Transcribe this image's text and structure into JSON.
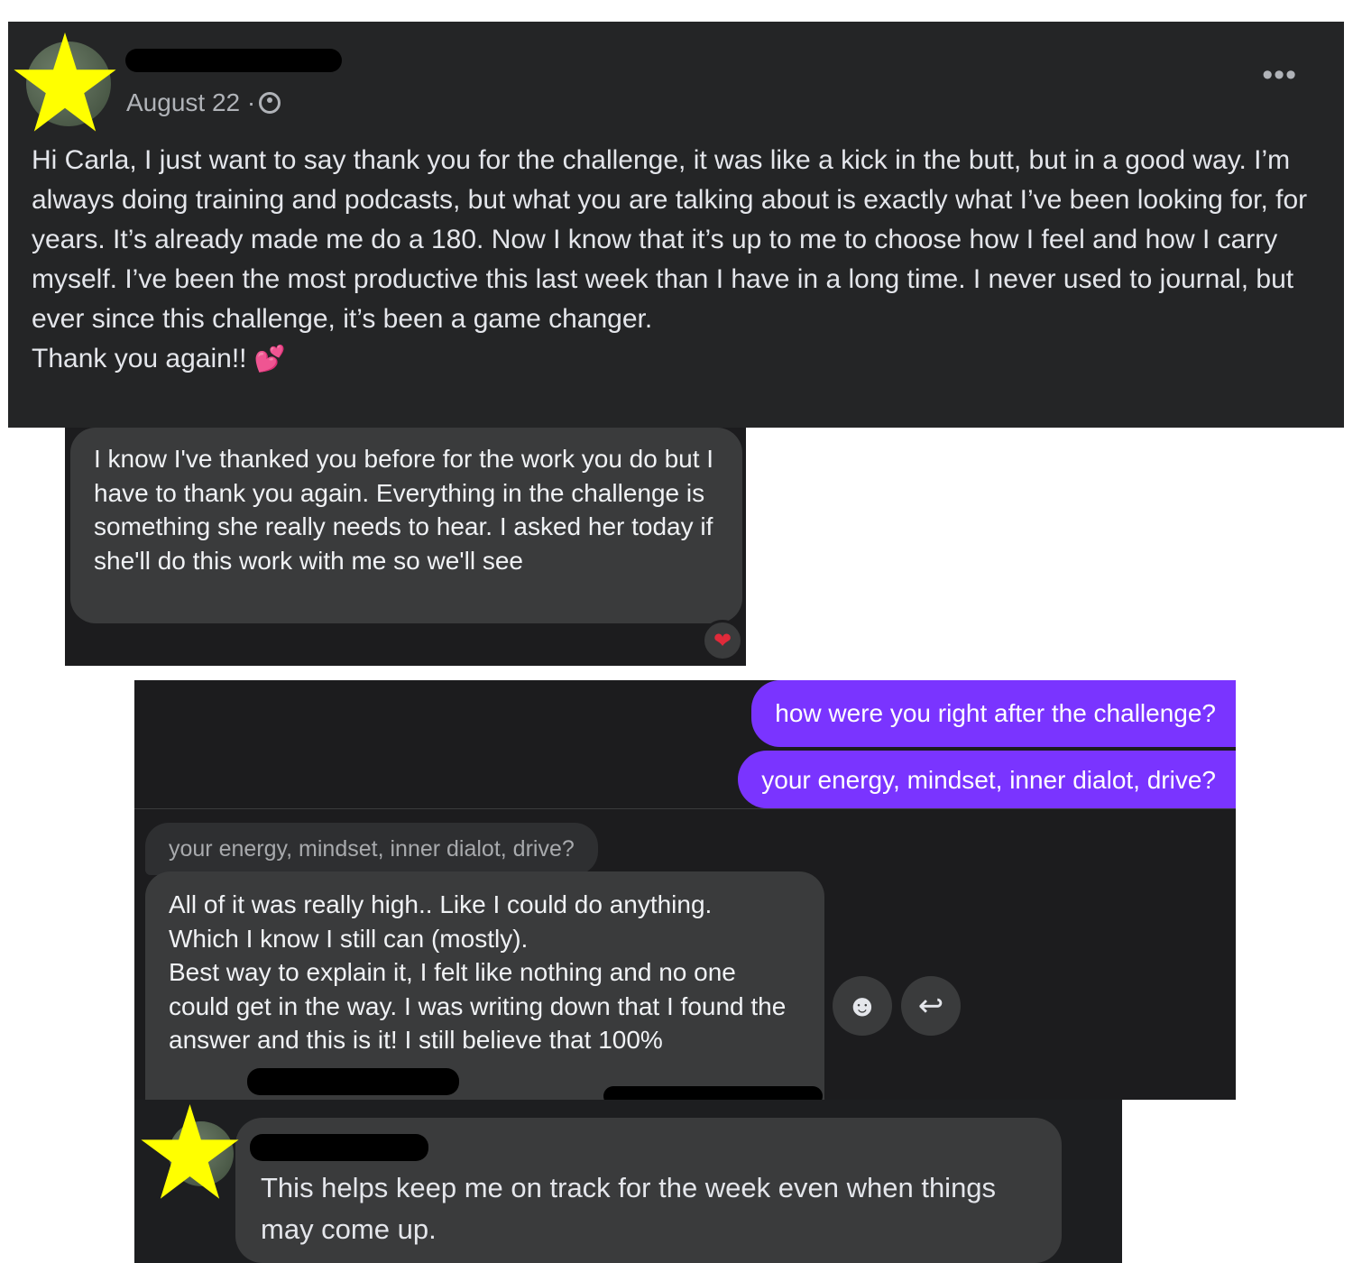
{
  "post": {
    "date": "August 22 ·",
    "more_label": "•••",
    "body": "Hi Carla, I just want to say thank you for the challenge, it was like a kick in the butt, but in a good way. I’m always doing training and podcasts, but what you are talking about is exactly what I’ve been looking for, for years. It’s already made me do a 180. Now I know that it’s up to me to choose how I feel and how I carry myself. I’ve been the most productive this last week than I have in a long time. I never used to journal, but ever since this challenge, it’s been a game changer.\nThank you again!!",
    "emoji": "💕"
  },
  "message1": {
    "text": "I know I've thanked you before for the work you do but I have to thank you again. Everything in the challenge is something she really needs to hear. I asked her today if she'll do this work with me so we'll see",
    "reaction": "❤"
  },
  "chat": {
    "outgoing": [
      "how were you right after the challenge?",
      "your energy, mindset, inner dialot, drive?"
    ],
    "quoted": "your energy, mindset, inner dialot, drive?",
    "reply": "All of it was really high.. Like I could do anything.\nWhich I know I still can (mostly).\nBest way to explain it, I felt like nothing and no one could get in the way. I was writing down that I found the answer and this is it! I still believe that 100%",
    "emoji_icon": "☻",
    "reply_icon": "↩"
  },
  "comment": {
    "text": "This helps keep me on track for the week even when things may come up."
  },
  "colors": {
    "dark_panel": "#242526",
    "bubble": "#3a3b3c",
    "outgoing_bubble": "#7a34ff",
    "star": "#ffff00",
    "reaction_heart": "#e02a3a"
  }
}
